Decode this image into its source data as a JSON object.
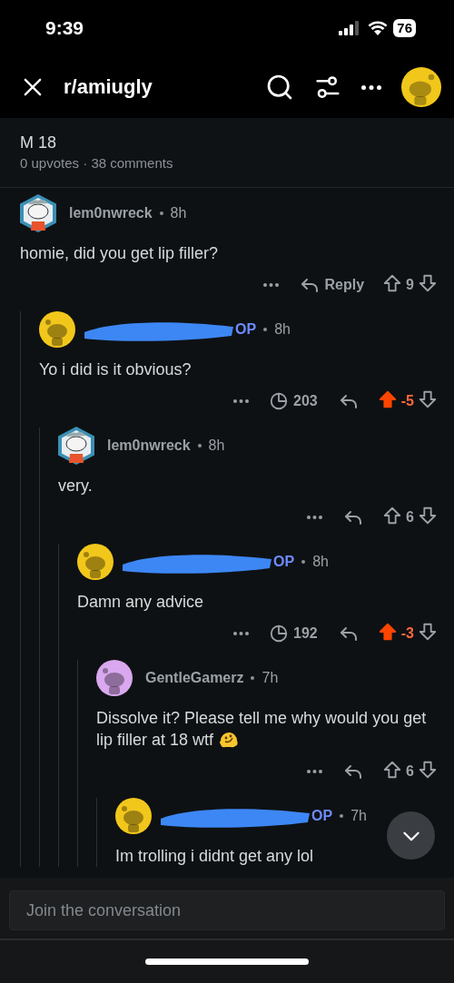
{
  "status_bar": {
    "time": "9:39",
    "battery": "76"
  },
  "nav": {
    "title": "r/amiugly"
  },
  "post": {
    "title": "M 18",
    "meta": "0 upvotes · 38 comments"
  },
  "comments": [
    {
      "redacted": false,
      "author": "lem0nwreck",
      "avatar": {
        "kind": "custom",
        "color": "#3b8fb5"
      },
      "time": "8h",
      "body": "homie, did you get lip filler?",
      "emoji": false,
      "reply_label": "Reply",
      "score": "9",
      "upvoted": false,
      "children": [
        {
          "redacted": true,
          "badge": "OP",
          "avatar": {
            "kind": "snoo",
            "color": "#f2c71b"
          },
          "time": "8h",
          "body": "Yo i did is it obvious?",
          "emoji": false,
          "awards": "203",
          "score": "-5",
          "upvoted": true,
          "children": [
            {
              "redacted": false,
              "author": "lem0nwreck",
              "avatar": {
                "kind": "custom",
                "color": "#3b8fb5"
              },
              "time": "8h",
              "body": "very.",
              "emoji": false,
              "score": "6",
              "upvoted": false,
              "children": [
                {
                  "redacted": true,
                  "badge": "OP",
                  "avatar": {
                    "kind": "snoo",
                    "color": "#f2c71b"
                  },
                  "time": "8h",
                  "body": "Damn any advice",
                  "emoji": false,
                  "awards": "192",
                  "score": "-3",
                  "upvoted": true,
                  "children": [
                    {
                      "redacted": false,
                      "author": "GentleGamerz",
                      "avatar": {
                        "kind": "snoo",
                        "color": "#d9a8ee"
                      },
                      "time": "7h",
                      "body": "Dissolve it? Please tell me why would you get lip filler at 18 wtf",
                      "emoji": true,
                      "score": "6",
                      "upvoted": false,
                      "children": [
                        {
                          "redacted": true,
                          "badge": "OP",
                          "avatar": {
                            "kind": "snoo",
                            "color": "#f2c71b"
                          },
                          "time": "7h",
                          "body": "Im trolling i didnt get any lol",
                          "emoji": false
                        }
                      ]
                    }
                  ]
                }
              ]
            }
          ]
        }
      ]
    }
  ],
  "composer": {
    "placeholder": "Join the conversation"
  }
}
